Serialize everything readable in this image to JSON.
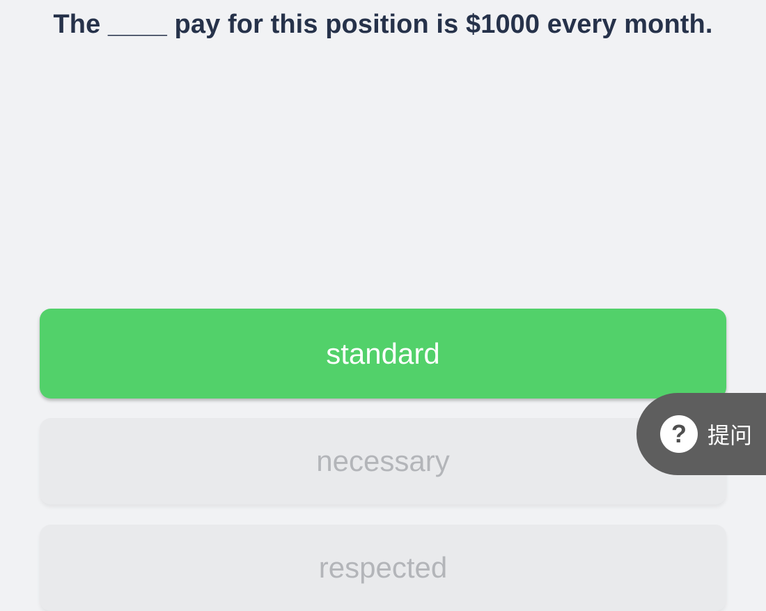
{
  "question": {
    "text": "The ____ pay for this position is $1000 every month."
  },
  "options": [
    {
      "label": "standard",
      "state": "correct"
    },
    {
      "label": "necessary",
      "state": "dimmed"
    },
    {
      "label": "respected",
      "state": "dimmed"
    }
  ],
  "ask_button": {
    "icon": "question-circle-icon",
    "icon_glyph": "?",
    "label": "提问"
  },
  "colors": {
    "background": "#f1f2f4",
    "question_text": "#26324a",
    "correct_option": "#52d16a",
    "dimmed_option": "#e9eaec",
    "dimmed_text": "#b3b5b9",
    "ask_button": "#5e5e5e"
  }
}
